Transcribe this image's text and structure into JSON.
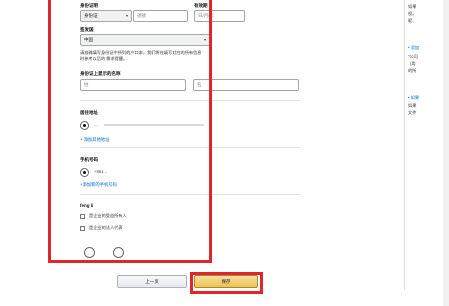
{
  "form": {
    "id_type_label": "身份证明",
    "id_type_value": "身份证",
    "id_number_placeholder": "號號",
    "expiry_label": "有效期",
    "expiry_placeholder": "日/月/年",
    "country_label": "签发国",
    "country_value": "中国",
    "note_text": "请准确填写身份证中所列的户口本，我们将在填写对应的所有信息时参考以后的 需求提醒。",
    "name_label": "身份证上显示的名称",
    "name_last_placeholder": "姓",
    "name_first_placeholder": "名",
    "address_label": "居住地址",
    "address_value": "...",
    "add_address_link": "+ 添加其他地址",
    "phone_label": "手机号码",
    "phone_value": "+861...",
    "add_phone_link": "+添加新的手机号码",
    "section_label": "feng li",
    "checkbox_owner": "是企业的受益所有人",
    "checkbox_legal": "是企业的法人代表"
  },
  "buttons": {
    "prev": "上一页",
    "save": "保存"
  },
  "right_panel": {
    "block1": [
      "如果",
      "权。",
      "昵、"
    ],
    "block2_title": "• 添加",
    "block2": [
      "\"公司",
      "(用",
      "的所"
    ],
    "block3_title": "• 如果",
    "block3": [
      "如果",
      "文件"
    ]
  }
}
